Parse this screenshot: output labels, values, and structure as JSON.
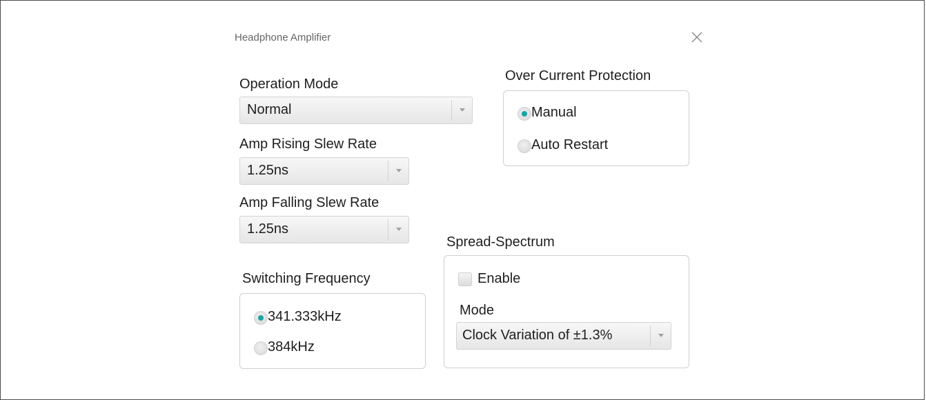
{
  "dialog": {
    "title": "Headphone Amplifier",
    "close_icon": "close-icon"
  },
  "operation_mode": {
    "label": "Operation Mode",
    "value": "Normal"
  },
  "amp_rising": {
    "label": "Amp Rising Slew Rate",
    "value": "1.25ns"
  },
  "amp_falling": {
    "label": "Amp Falling Slew Rate",
    "value": "1.25ns"
  },
  "switching_frequency": {
    "label": "Switching Frequency",
    "options": [
      "341.333kHz",
      "384kHz"
    ],
    "selected": "341.333kHz"
  },
  "over_current": {
    "label": "Over Current Protection",
    "options": [
      "Manual",
      "Auto Restart"
    ],
    "selected": "Manual"
  },
  "spread_spectrum": {
    "label": "Spread-Spectrum",
    "enable_label": "Enable",
    "enabled": false,
    "mode_label": "Mode",
    "mode_value": "Clock Variation of ±1.3%"
  },
  "colors": {
    "accent": "#1aa3a3",
    "border": "#cfcfcf",
    "text": "#1e1e1e"
  }
}
